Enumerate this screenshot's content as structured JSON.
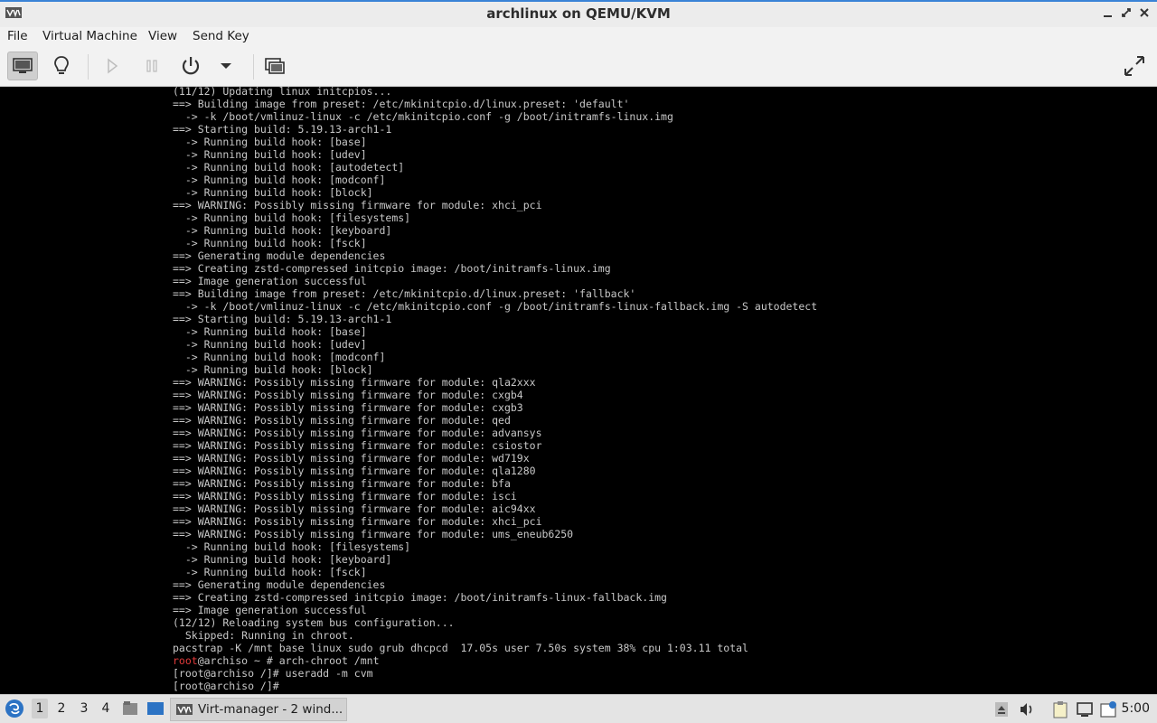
{
  "window": {
    "title": "archlinux on QEMU/KVM"
  },
  "menu": {
    "items": [
      "File",
      "Virtual Machine",
      "View",
      "Send Key"
    ]
  },
  "toolbar": {
    "icons": [
      "console-icon",
      "details-lightbulb-icon",
      "run-icon",
      "pause-icon",
      "power-icon",
      "power-menu-chevron-icon",
      "snapshots-icon",
      "fullscreen-icon"
    ]
  },
  "console": {
    "lines": [
      "(11/12) Updating linux initcpios...",
      "==> Building image from preset: /etc/mkinitcpio.d/linux.preset: 'default'",
      "  -> -k /boot/vmlinuz-linux -c /etc/mkinitcpio.conf -g /boot/initramfs-linux.img",
      "==> Starting build: 5.19.13-arch1-1",
      "  -> Running build hook: [base]",
      "  -> Running build hook: [udev]",
      "  -> Running build hook: [autodetect]",
      "  -> Running build hook: [modconf]",
      "  -> Running build hook: [block]",
      "==> WARNING: Possibly missing firmware for module: xhci_pci",
      "  -> Running build hook: [filesystems]",
      "  -> Running build hook: [keyboard]",
      "  -> Running build hook: [fsck]",
      "==> Generating module dependencies",
      "==> Creating zstd-compressed initcpio image: /boot/initramfs-linux.img",
      "==> Image generation successful",
      "==> Building image from preset: /etc/mkinitcpio.d/linux.preset: 'fallback'",
      "  -> -k /boot/vmlinuz-linux -c /etc/mkinitcpio.conf -g /boot/initramfs-linux-fallback.img -S autodetect",
      "==> Starting build: 5.19.13-arch1-1",
      "  -> Running build hook: [base]",
      "  -> Running build hook: [udev]",
      "  -> Running build hook: [modconf]",
      "  -> Running build hook: [block]",
      "==> WARNING: Possibly missing firmware for module: qla2xxx",
      "==> WARNING: Possibly missing firmware for module: cxgb4",
      "==> WARNING: Possibly missing firmware for module: cxgb3",
      "==> WARNING: Possibly missing firmware for module: qed",
      "==> WARNING: Possibly missing firmware for module: advansys",
      "==> WARNING: Possibly missing firmware for module: csiostor",
      "==> WARNING: Possibly missing firmware for module: wd719x",
      "==> WARNING: Possibly missing firmware for module: qla1280",
      "==> WARNING: Possibly missing firmware for module: bfa",
      "==> WARNING: Possibly missing firmware for module: isci",
      "==> WARNING: Possibly missing firmware for module: aic94xx",
      "==> WARNING: Possibly missing firmware for module: xhci_pci",
      "==> WARNING: Possibly missing firmware for module: ums_eneub6250",
      "  -> Running build hook: [filesystems]",
      "  -> Running build hook: [keyboard]",
      "  -> Running build hook: [fsck]",
      "==> Generating module dependencies",
      "==> Creating zstd-compressed initcpio image: /boot/initramfs-linux-fallback.img",
      "==> Image generation successful",
      "(12/12) Reloading system bus configuration...",
      "  Skipped: Running in chroot.",
      "pacstrap -K /mnt base linux sudo grub dhcpcd  17.05s user 7.50s system 38% cpu 1:03.11 total"
    ],
    "prompt_user": "root",
    "prompt_rest": "@archiso ~ # arch-chroot /mnt",
    "tail_lines": [
      "[root@archiso /]# useradd -m cvm",
      "[root@archiso /]# "
    ]
  },
  "taskbar": {
    "workspaces": [
      "1",
      "2",
      "3",
      "4"
    ],
    "task_label": "Virt-manager - 2 wind...",
    "clock": "5:00"
  },
  "colors": {
    "accent": "#3a83d6",
    "prompt_user": "#e23b3b",
    "console_text": "#c8c8c8"
  }
}
